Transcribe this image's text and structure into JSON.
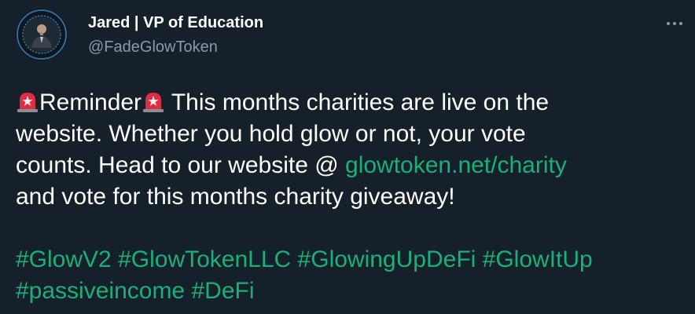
{
  "tweet": {
    "display_name": "Jared | VP of Education",
    "handle": "@FadeGlowToken",
    "line1": {
      "reminder": "Reminder",
      "rest": " This months charities are live on the"
    },
    "line2": "website. Whether you hold glow or not, your vote",
    "line3": {
      "text": "counts. Head to our website @ ",
      "link": "glowtoken.net/charity"
    },
    "line4": "and vote for this months charity giveaway!",
    "hashtags_line1": [
      "#GlowV2",
      "#GlowTokenLLC",
      "#GlowingUpDeFi",
      "#GlowItUp"
    ],
    "hashtags_line2": [
      "#passiveincome",
      "#DeFi"
    ]
  },
  "icons": {
    "avatar": "profile-photo",
    "more": "more-options-icon",
    "emoji": "police-car-light-icon"
  },
  "colors": {
    "background": "#15202b",
    "text": "#ffffff",
    "secondary_text": "#8b98a5",
    "link": "#1ab07a"
  }
}
